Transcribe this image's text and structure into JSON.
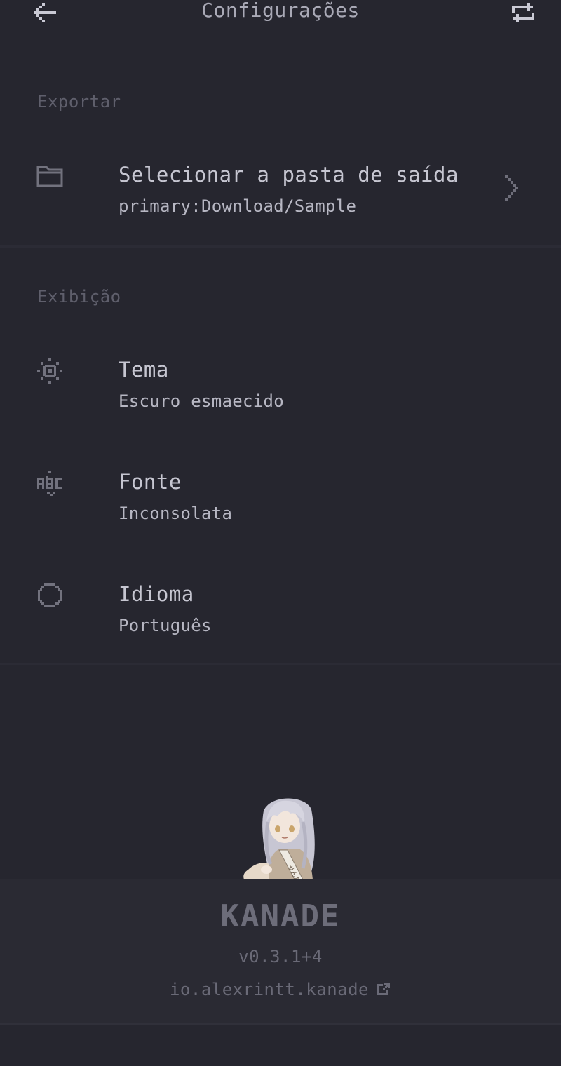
{
  "app_bar": {
    "title": "Configurações",
    "back_icon": "arrow-left-icon",
    "sync_icon": "repeat-icon"
  },
  "sections": {
    "export": {
      "label": "Exportar",
      "output_folder": {
        "icon": "folder-icon",
        "title": "Selecionar a pasta de saída",
        "value": "primary:Download/Sample",
        "chevron_icon": "chevron-right-icon"
      }
    },
    "display": {
      "label": "Exibição",
      "theme": {
        "icon": "brightness-icon",
        "title": "Tema",
        "value": "Escuro esmaecido"
      },
      "font": {
        "icon": "font-abc-icon",
        "title": "Fonte",
        "value": "Inconsolata"
      },
      "language": {
        "icon": "globe-icon",
        "title": "Idioma",
        "value": "Português"
      }
    }
  },
  "footer": {
    "brand": "KANADE",
    "version": "v0.3.1+4",
    "package": "io.alexrintt.kanade",
    "external_icon": "external-link-icon",
    "mascot": "mascot-image"
  },
  "colors": {
    "background": "#26262f",
    "footer_background": "#2a2a33",
    "primary_text": "#c6c6d1",
    "section_label": "#5f5f6c",
    "muted_text": "#6a6a77"
  }
}
